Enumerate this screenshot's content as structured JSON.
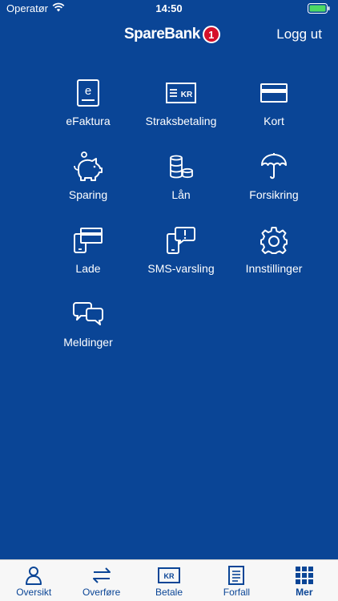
{
  "status_bar": {
    "carrier": "Operatør",
    "time": "14:50"
  },
  "header": {
    "brand": "SpareBank",
    "brand_number": "1",
    "logout_label": "Logg ut"
  },
  "menu": [
    {
      "label": "eFaktura",
      "icon": "efaktura-icon"
    },
    {
      "label": "Straksbetaling",
      "icon": "instant-payment-icon",
      "icon_text": "KR"
    },
    {
      "label": "Kort",
      "icon": "card-icon"
    },
    {
      "label": "Sparing",
      "icon": "piggy-bank-icon"
    },
    {
      "label": "Lån",
      "icon": "coins-icon"
    },
    {
      "label": "Forsikring",
      "icon": "umbrella-icon"
    },
    {
      "label": "Lade",
      "icon": "phone-card-icon"
    },
    {
      "label": "SMS-varsling",
      "icon": "sms-alert-icon"
    },
    {
      "label": "Innstillinger",
      "icon": "gear-icon"
    },
    {
      "label": "Meldinger",
      "icon": "chat-bubbles-icon"
    }
  ],
  "tabs": [
    {
      "label": "Oversikt",
      "icon": "person-icon",
      "active": false
    },
    {
      "label": "Overføre",
      "icon": "transfer-arrows-icon",
      "active": false
    },
    {
      "label": "Betale",
      "icon": "pay-icon",
      "icon_text": "KR",
      "active": false
    },
    {
      "label": "Forfall",
      "icon": "document-icon",
      "active": false
    },
    {
      "label": "Mer",
      "icon": "grid-icon",
      "active": true
    }
  ],
  "colors": {
    "background": "#0a4596",
    "brand_red": "#d5102a",
    "tabbar": "#f7f7f7",
    "battery": "#4cd964"
  }
}
